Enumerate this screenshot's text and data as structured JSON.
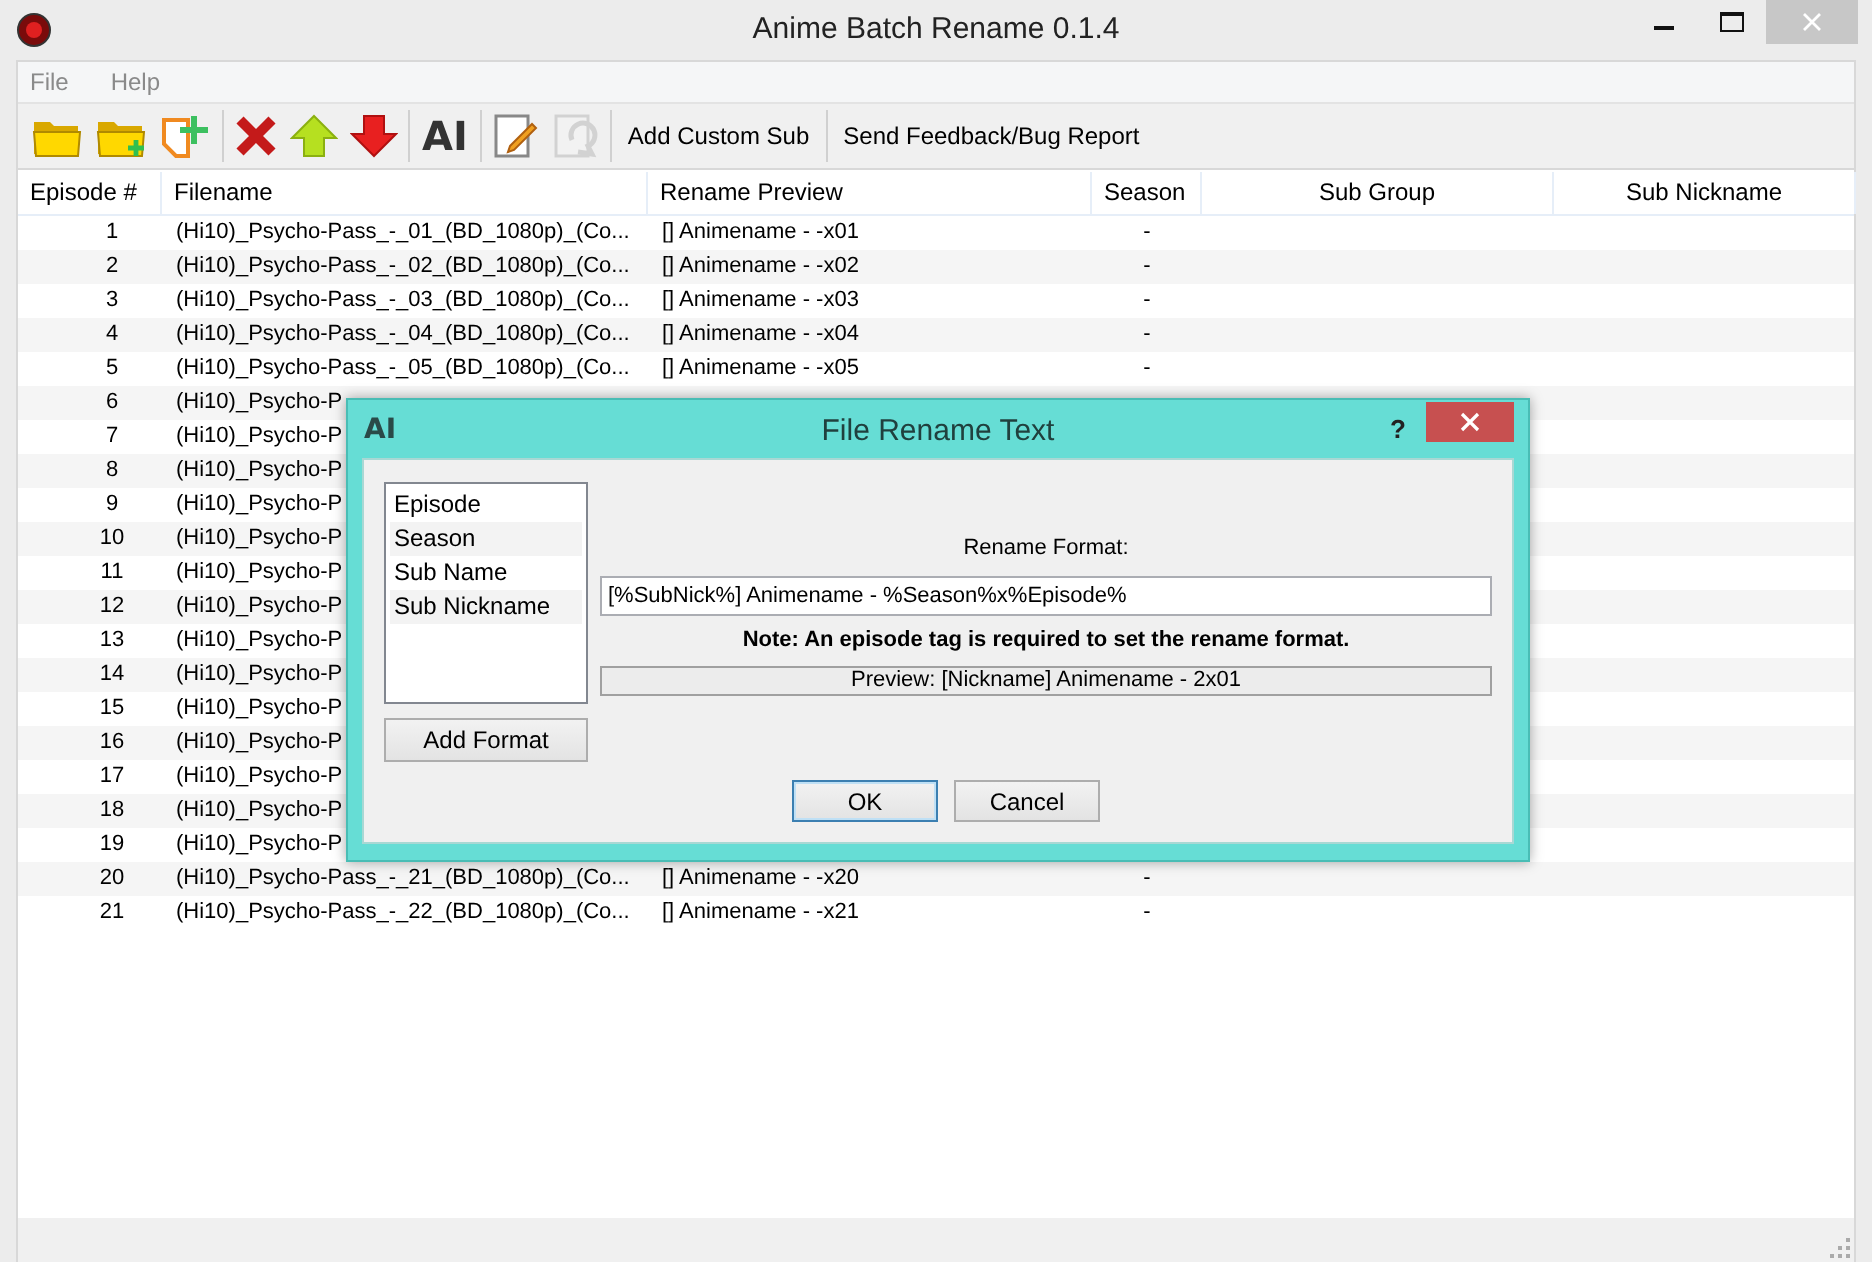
{
  "window": {
    "title": "Anime Batch Rename 0.1.4"
  },
  "menu": [
    {
      "label": "File"
    },
    {
      "label": "Help"
    }
  ],
  "toolbar": {
    "groups": [
      [
        {
          "kind": "open-folder",
          "disabled": false
        },
        {
          "kind": "add-folder",
          "disabled": false
        },
        {
          "kind": "add-file",
          "disabled": false
        }
      ],
      [
        {
          "kind": "delete",
          "disabled": false
        },
        {
          "kind": "move-up",
          "disabled": false
        },
        {
          "kind": "move-down",
          "disabled": false
        }
      ],
      [
        {
          "kind": "rename-text",
          "glyph": "AI",
          "disabled": false
        }
      ],
      [
        {
          "kind": "edit",
          "disabled": false
        },
        {
          "kind": "undo",
          "disabled": true
        }
      ]
    ],
    "text_buttons": [
      "Add Custom Sub",
      "Send Feedback/Bug Report"
    ]
  },
  "table": {
    "columns": [
      "Episode #",
      "Filename",
      "Rename Preview",
      "Season",
      "Sub Group",
      "Sub Nickname"
    ],
    "rows": [
      {
        "episode": "1",
        "filename": "(Hi10)_Psycho-Pass_-_01_(BD_1080p)_(Co...",
        "preview": "[] Animename - -x01",
        "season": "-"
      },
      {
        "episode": "2",
        "filename": "(Hi10)_Psycho-Pass_-_02_(BD_1080p)_(Co...",
        "preview": "[] Animename - -x02",
        "season": "-"
      },
      {
        "episode": "3",
        "filename": "(Hi10)_Psycho-Pass_-_03_(BD_1080p)_(Co...",
        "preview": "[] Animename - -x03",
        "season": "-"
      },
      {
        "episode": "4",
        "filename": "(Hi10)_Psycho-Pass_-_04_(BD_1080p)_(Co...",
        "preview": "[] Animename - -x04",
        "season": "-"
      },
      {
        "episode": "5",
        "filename": "(Hi10)_Psycho-Pass_-_05_(BD_1080p)_(Co...",
        "preview": "[] Animename - -x05",
        "season": "-"
      },
      {
        "episode": "6",
        "filename": "(Hi10)_Psycho-P"
      },
      {
        "episode": "7",
        "filename": "(Hi10)_Psycho-P"
      },
      {
        "episode": "8",
        "filename": "(Hi10)_Psycho-P"
      },
      {
        "episode": "9",
        "filename": "(Hi10)_Psycho-P"
      },
      {
        "episode": "10",
        "filename": "(Hi10)_Psycho-P"
      },
      {
        "episode": "11",
        "filename": "(Hi10)_Psycho-P"
      },
      {
        "episode": "12",
        "filename": "(Hi10)_Psycho-P"
      },
      {
        "episode": "13",
        "filename": "(Hi10)_Psycho-P"
      },
      {
        "episode": "14",
        "filename": "(Hi10)_Psycho-P"
      },
      {
        "episode": "15",
        "filename": "(Hi10)_Psycho-P"
      },
      {
        "episode": "16",
        "filename": "(Hi10)_Psycho-P"
      },
      {
        "episode": "17",
        "filename": "(Hi10)_Psycho-P"
      },
      {
        "episode": "18",
        "filename": "(Hi10)_Psycho-P"
      },
      {
        "episode": "19",
        "filename": "(Hi10)_Psycho-P"
      },
      {
        "episode": "20",
        "filename": "(Hi10)_Psycho-Pass_-_21_(BD_1080p)_(Co...",
        "preview": "[] Animename - -x20",
        "season": "-"
      },
      {
        "episode": "21",
        "filename": "(Hi10)_Psycho-Pass_-_22_(BD_1080p)_(Co...",
        "preview": "[] Animename - -x21",
        "season": "-"
      }
    ]
  },
  "dialog": {
    "icon_glyph": "AI",
    "title": "File Rename Text",
    "help": "?",
    "format_tags": [
      "Episode",
      "Season",
      "Sub Name",
      "Sub Nickname"
    ],
    "add_format_button": "Add Format",
    "rename_format_label": "Rename Format:",
    "rename_format_value": "[%SubNick%] Animename - %Season%x%Episode%",
    "note": "Note: An episode tag is required to set the rename format.",
    "preview": "Preview: [Nickname] Animename - 2x01",
    "buttons": [
      {
        "label": "OK",
        "default": true
      },
      {
        "label": "Cancel",
        "default": false
      }
    ]
  }
}
